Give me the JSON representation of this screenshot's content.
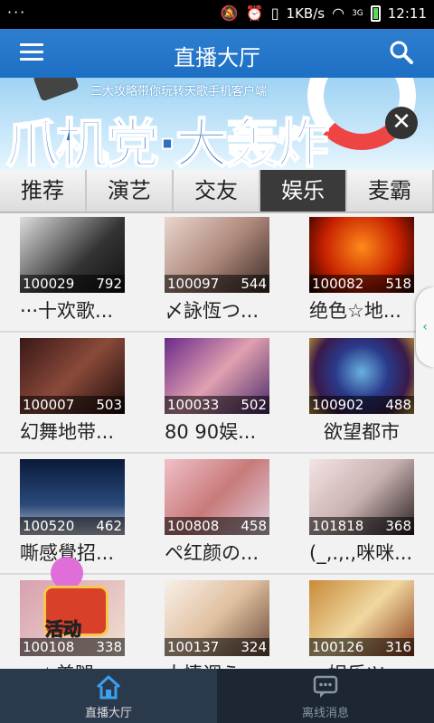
{
  "status_bar": {
    "left_indicator": "···",
    "network": "1KB/s",
    "signal": "3G",
    "time": "12:11"
  },
  "header": {
    "title": "直播大厅",
    "menu_icon": "hamburger-icon",
    "search_icon": "search-icon"
  },
  "banner": {
    "subtitle": "三大攻略带你玩转天歌手机客户端",
    "headline": "爪机党·大轰炸",
    "close_label": "✕"
  },
  "tabs": [
    {
      "label": "推荐"
    },
    {
      "label": "演艺"
    },
    {
      "label": "交友"
    },
    {
      "label": "娱乐"
    },
    {
      "label": "麦霸"
    }
  ],
  "active_tab": "娱乐",
  "rooms": [
    {
      "id": "100029",
      "viewers": "792",
      "name": "···十欢歌..."
    },
    {
      "id": "100097",
      "viewers": "544",
      "name": "〆詠恆つ..."
    },
    {
      "id": "100082",
      "viewers": "518",
      "name": "绝色☆地..."
    },
    {
      "id": "100007",
      "viewers": "503",
      "name": "幻舞地带..."
    },
    {
      "id": "100033",
      "viewers": "502",
      "name": "80 90娱..."
    },
    {
      "id": "100902",
      "viewers": "488",
      "name": "欲望都市"
    },
    {
      "id": "100520",
      "viewers": "462",
      "name": "嘶感覺招..."
    },
    {
      "id": "100808",
      "viewers": "458",
      "name": "ペ红颜の..."
    },
    {
      "id": "101818",
      "viewers": "368",
      "name": "(_,.,.,咪咪..."
    },
    {
      "id": "100108",
      "viewers": "338",
      "name": "丶☆美腿"
    },
    {
      "id": "100137",
      "viewers": "324",
      "name": "大情调う"
    },
    {
      "id": "100126",
      "viewers": "316",
      "name": "〃娱乐ツ"
    }
  ],
  "activity_label": "活动",
  "side_tab_arrow": "‹",
  "bottom_nav": [
    {
      "label": "直播大厅",
      "icon": "home-icon"
    },
    {
      "label": "离线消息",
      "icon": "message-icon"
    }
  ],
  "colors": {
    "header": "#2377c9",
    "active_tab": "#3a3a3a",
    "bottom_bar": "#1c2733"
  }
}
